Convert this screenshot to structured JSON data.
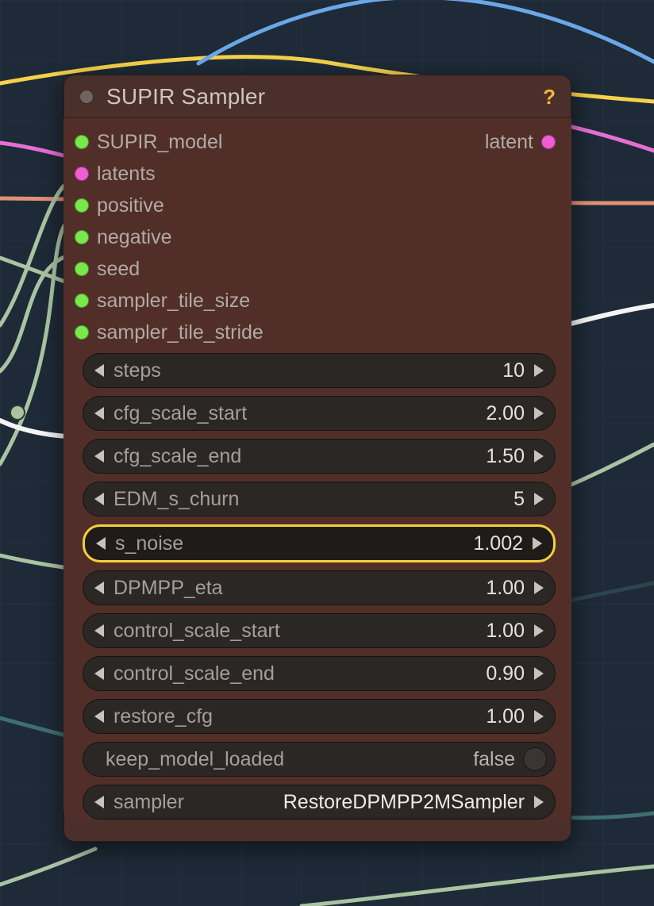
{
  "node": {
    "title": "SUPIR Sampler",
    "help_icon": "?",
    "inputs": [
      {
        "label": "SUPIR_model",
        "color": "#79e84d"
      },
      {
        "label": "latents",
        "color": "#ef5ed3"
      },
      {
        "label": "positive",
        "color": "#79e84d"
      },
      {
        "label": "negative",
        "color": "#79e84d"
      },
      {
        "label": "seed",
        "color": "#79e84d"
      },
      {
        "label": "sampler_tile_size",
        "color": "#79e84d"
      },
      {
        "label": "sampler_tile_stride",
        "color": "#79e84d"
      }
    ],
    "outputs": [
      {
        "label": "latent",
        "color": "#ef5ed3"
      }
    ],
    "params": [
      {
        "label": "steps",
        "value": "10"
      },
      {
        "label": "cfg_scale_start",
        "value": "2.00"
      },
      {
        "label": "cfg_scale_end",
        "value": "1.50"
      },
      {
        "label": "EDM_s_churn",
        "value": "5"
      },
      {
        "label": "s_noise",
        "value": "1.002",
        "selected": true
      },
      {
        "label": "DPMPP_eta",
        "value": "1.00"
      },
      {
        "label": "control_scale_start",
        "value": "1.00"
      },
      {
        "label": "control_scale_end",
        "value": "0.90"
      },
      {
        "label": "restore_cfg",
        "value": "1.00"
      }
    ],
    "toggle": {
      "label": "keep_model_loaded",
      "value": "false"
    },
    "combo": {
      "label": "sampler",
      "value": "RestoreDPMPP2MSampler"
    }
  }
}
